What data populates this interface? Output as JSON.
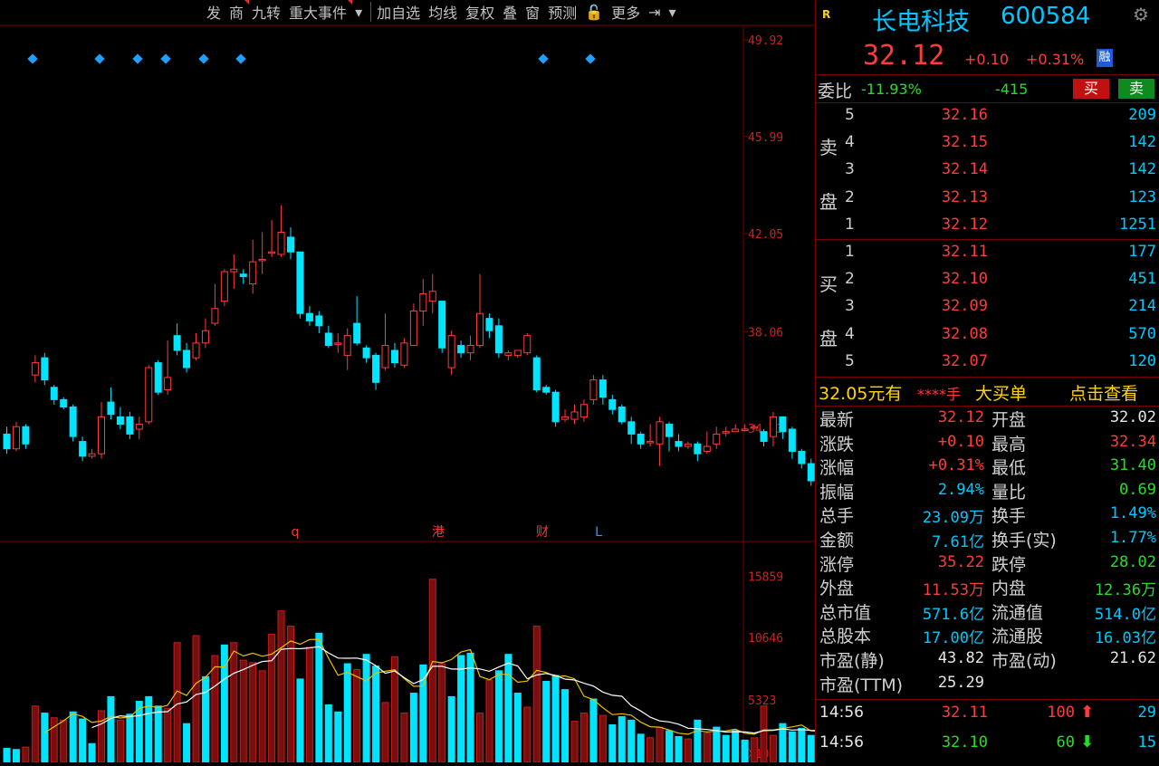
{
  "toolbar": {
    "items": [
      "发",
      "商",
      "九转",
      "重大事件",
      "▾",
      "加自选",
      "均线",
      "复权",
      "叠",
      "窗",
      "预测",
      "🔓",
      "更多",
      "⇥",
      "▾"
    ]
  },
  "price_axis": [
    "49.92",
    "45.99",
    "42.05",
    "38.06",
    "34.13"
  ],
  "volume_axis": [
    "15859",
    "10646",
    "5323",
    "X100"
  ],
  "event_markers": [
    "q",
    "港",
    "财",
    "L"
  ],
  "stock": {
    "name": "长电科技",
    "code": "600584",
    "price": "32.12",
    "change": "+0.10",
    "pct": "+0.31%",
    "badge": "融",
    "tag": "R"
  },
  "weibi": {
    "label": "委比",
    "pct": "-11.93%",
    "diff": "-415",
    "buy_btn": "买",
    "sell_btn": "卖"
  },
  "sell_side": {
    "label1": "卖",
    "label2": "盘",
    "levels": [
      {
        "n": "5",
        "price": "32.16",
        "vol": "209"
      },
      {
        "n": "4",
        "price": "32.15",
        "vol": "142"
      },
      {
        "n": "3",
        "price": "32.14",
        "vol": "142"
      },
      {
        "n": "2",
        "price": "32.13",
        "vol": "123"
      },
      {
        "n": "1",
        "price": "32.12",
        "vol": "1251"
      }
    ]
  },
  "buy_side": {
    "label1": "买",
    "label2": "盘",
    "levels": [
      {
        "n": "1",
        "price": "32.11",
        "vol": "177"
      },
      {
        "n": "2",
        "price": "32.10",
        "vol": "451"
      },
      {
        "n": "3",
        "price": "32.09",
        "vol": "214"
      },
      {
        "n": "4",
        "price": "32.08",
        "vol": "570"
      },
      {
        "n": "5",
        "price": "32.07",
        "vol": "120"
      }
    ]
  },
  "big_order": {
    "price": "32.05元有",
    "hands": "****手",
    "label": "大买单",
    "link": "点击查看"
  },
  "stats": [
    {
      "l1": "最新",
      "v1": "32.12",
      "c1": "red",
      "l2": "开盘",
      "v2": "32.02",
      "c2": "white"
    },
    {
      "l1": "涨跌",
      "v1": "+0.10",
      "c1": "red",
      "l2": "最高",
      "v2": "32.34",
      "c2": "red"
    },
    {
      "l1": "涨幅",
      "v1": "+0.31%",
      "c1": "red",
      "l2": "最低",
      "v2": "31.40",
      "c2": "green"
    },
    {
      "l1": "振幅",
      "v1": "2.94%",
      "c1": "cyan",
      "l2": "量比",
      "v2": "0.69",
      "c2": "green"
    },
    {
      "l1": "总手",
      "v1": "23.09万",
      "c1": "cyan",
      "l2": "换手",
      "v2": "1.49%",
      "c2": "cyan"
    },
    {
      "l1": "金额",
      "v1": "7.61亿",
      "c1": "cyan",
      "l2": "换手(实)",
      "v2": "1.77%",
      "c2": "cyan"
    },
    {
      "l1": "涨停",
      "v1": "35.22",
      "c1": "red",
      "l2": "跌停",
      "v2": "28.02",
      "c2": "green"
    },
    {
      "l1": "外盘",
      "v1": "11.53万",
      "c1": "red",
      "l2": "内盘",
      "v2": "12.36万",
      "c2": "green"
    },
    {
      "l1": "总市值",
      "v1": "571.6亿",
      "c1": "cyan",
      "l2": "流通值",
      "v2": "514.0亿",
      "c2": "cyan"
    },
    {
      "l1": "总股本",
      "v1": "17.00亿",
      "c1": "cyan",
      "l2": "流通股",
      "v2": "16.03亿",
      "c2": "cyan"
    },
    {
      "l1": "市盈(静)",
      "v1": "43.82",
      "c1": "white",
      "l2": "市盈(动)",
      "v2": "21.62",
      "c2": "white"
    },
    {
      "l1": "市盈(TTM)",
      "v1": "25.29",
      "c1": "white",
      "l2": "",
      "v2": "",
      "c2": "white"
    }
  ],
  "ticks": [
    {
      "time": "14:56",
      "price": "32.11",
      "vol": "100",
      "dir": "up",
      "count": "29"
    },
    {
      "time": "14:56",
      "price": "32.10",
      "vol": "60",
      "dir": "down",
      "count": "15"
    }
  ],
  "colors": {
    "up": "#ff3b3b",
    "down": "#00e5ff",
    "ma5": "#ffffff",
    "ma10": "#e8c000",
    "grid": "#7a0000"
  },
  "chart_data": {
    "type": "candlestick",
    "price_ylim": [
      30.2,
      50.8
    ],
    "candles": [
      [
        33.9,
        33.3,
        34.2,
        33.1
      ],
      [
        33.3,
        34.2,
        34.4,
        33.2
      ],
      [
        34.2,
        33.5,
        34.3,
        33.3
      ],
      [
        36.3,
        36.8,
        37.1,
        36.0
      ],
      [
        37.0,
        36.1,
        37.2,
        35.9
      ],
      [
        35.8,
        35.3,
        35.9,
        35.1
      ],
      [
        35.3,
        35.0,
        35.4,
        34.9
      ],
      [
        35.0,
        33.8,
        35.1,
        33.6
      ],
      [
        33.6,
        33.0,
        33.8,
        32.8
      ],
      [
        33.0,
        33.1,
        33.3,
        32.9
      ],
      [
        33.1,
        34.6,
        35.2,
        32.9
      ],
      [
        35.2,
        34.7,
        35.8,
        34.5
      ],
      [
        34.6,
        34.3,
        35.0,
        34.1
      ],
      [
        34.6,
        33.9,
        34.8,
        33.7
      ],
      [
        34.1,
        34.3,
        34.6,
        33.7
      ],
      [
        34.4,
        36.6,
        36.7,
        34.3
      ],
      [
        36.8,
        35.6,
        36.9,
        35.5
      ],
      [
        35.7,
        36.2,
        37.7,
        35.5
      ],
      [
        37.9,
        37.3,
        38.4,
        37.1
      ],
      [
        37.3,
        36.6,
        37.6,
        36.4
      ],
      [
        37.0,
        37.6,
        38.0,
        36.9
      ],
      [
        37.6,
        38.1,
        38.6,
        37.4
      ],
      [
        38.4,
        39.0,
        40.0,
        38.3
      ],
      [
        39.3,
        40.5,
        40.6,
        39.1
      ],
      [
        40.5,
        40.6,
        41.2,
        39.8
      ],
      [
        40.4,
        40.3,
        40.6,
        40.0
      ],
      [
        40.0,
        40.9,
        41.8,
        39.6
      ],
      [
        41.0,
        41.0,
        42.1,
        40.4
      ],
      [
        41.3,
        41.3,
        42.6,
        41.1
      ],
      [
        41.2,
        42.1,
        43.2,
        41.1
      ],
      [
        41.9,
        41.3,
        42.3,
        41.0
      ],
      [
        41.3,
        38.8,
        41.3,
        38.6
      ],
      [
        38.8,
        38.5,
        39.1,
        38.3
      ],
      [
        38.7,
        38.3,
        38.9,
        38.0
      ],
      [
        38.0,
        37.5,
        38.3,
        37.4
      ],
      [
        37.6,
        37.6,
        38.0,
        37.2
      ],
      [
        37.1,
        37.9,
        38.2,
        36.5
      ],
      [
        38.4,
        37.6,
        39.5,
        37.5
      ],
      [
        37.4,
        37.0,
        37.5,
        36.8
      ],
      [
        37.1,
        36.0,
        37.2,
        35.7
      ],
      [
        36.6,
        37.5,
        38.8,
        36.5
      ],
      [
        37.3,
        36.8,
        37.6,
        36.6
      ],
      [
        36.7,
        37.6,
        37.8,
        36.6
      ],
      [
        37.5,
        38.9,
        39.2,
        37.5
      ],
      [
        38.9,
        39.6,
        40.2,
        38.3
      ],
      [
        39.3,
        39.7,
        40.4,
        38.8
      ],
      [
        39.3,
        37.4,
        39.3,
        37.2
      ],
      [
        36.6,
        37.9,
        38.1,
        36.3
      ],
      [
        37.5,
        37.2,
        37.7,
        37.0
      ],
      [
        37.2,
        37.5,
        37.9,
        36.9
      ],
      [
        37.5,
        38.8,
        40.4,
        37.4
      ],
      [
        38.6,
        38.1,
        38.8,
        37.8
      ],
      [
        38.3,
        37.2,
        38.6,
        37.0
      ],
      [
        37.1,
        37.2,
        37.3,
        36.9
      ],
      [
        37.1,
        37.3,
        37.3,
        37.0
      ],
      [
        37.2,
        37.9,
        38.0,
        37.1
      ],
      [
        37.0,
        35.7,
        37.1,
        35.6
      ],
      [
        35.8,
        35.6,
        35.9,
        35.5
      ],
      [
        35.6,
        34.4,
        35.7,
        34.2
      ],
      [
        34.5,
        34.6,
        34.9,
        34.4
      ],
      [
        34.5,
        34.8,
        35.1,
        34.3
      ],
      [
        34.6,
        35.1,
        35.3,
        34.4
      ],
      [
        35.3,
        36.1,
        36.3,
        35.1
      ],
      [
        36.1,
        35.4,
        36.3,
        35.1
      ],
      [
        35.3,
        34.9,
        35.5,
        34.7
      ],
      [
        35.0,
        34.4,
        35.1,
        34.3
      ],
      [
        34.4,
        33.9,
        34.6,
        33.5
      ],
      [
        33.9,
        33.5,
        34.0,
        33.3
      ],
      [
        33.6,
        33.6,
        34.3,
        33.4
      ],
      [
        33.5,
        34.4,
        34.6,
        32.6
      ],
      [
        34.3,
        33.8,
        34.4,
        33.2
      ],
      [
        33.6,
        33.4,
        33.9,
        33.2
      ],
      [
        33.4,
        33.5,
        33.6,
        33.3
      ],
      [
        33.5,
        33.1,
        33.6,
        32.8
      ],
      [
        33.2,
        33.4,
        34.0,
        33.1
      ],
      [
        33.5,
        33.9,
        34.2,
        33.3
      ],
      [
        34.0,
        34.0,
        34.2,
        33.8
      ],
      [
        34.0,
        34.1,
        34.3,
        34.0
      ],
      [
        34.1,
        34.1,
        34.3,
        34.0
      ],
      [
        34.2,
        34.2,
        34.3,
        34.1
      ],
      [
        34.0,
        33.6,
        34.1,
        33.4
      ],
      [
        33.8,
        34.6,
        34.8,
        33.4
      ],
      [
        34.6,
        34.0,
        34.6,
        33.7
      ],
      [
        34.1,
        33.2,
        34.2,
        32.9
      ],
      [
        33.2,
        32.7,
        33.3,
        32.5
      ],
      [
        32.7,
        32.0,
        32.9,
        31.8
      ],
      [
        32.0,
        32.1,
        32.3,
        31.4
      ]
    ],
    "volume_ylim": [
      0,
      16500
    ],
    "volumes": [
      [
        1200,
        "d"
      ],
      [
        1100,
        "d"
      ],
      [
        1300,
        "u"
      ],
      [
        4800,
        "u"
      ],
      [
        4200,
        "d"
      ],
      [
        3800,
        "u"
      ],
      [
        3600,
        "u"
      ],
      [
        4300,
        "d"
      ],
      [
        3700,
        "d"
      ],
      [
        1600,
        "d"
      ],
      [
        4400,
        "u"
      ],
      [
        5600,
        "d"
      ],
      [
        3600,
        "u"
      ],
      [
        4100,
        "d"
      ],
      [
        5200,
        "d"
      ],
      [
        5600,
        "d"
      ],
      [
        4800,
        "d"
      ],
      [
        4600,
        "u"
      ],
      [
        10200,
        "u"
      ],
      [
        3300,
        "d"
      ],
      [
        10800,
        "u"
      ],
      [
        7300,
        "d"
      ],
      [
        9100,
        "u"
      ],
      [
        10000,
        "d"
      ],
      [
        10200,
        "u"
      ],
      [
        8700,
        "u"
      ],
      [
        8500,
        "u"
      ],
      [
        7800,
        "u"
      ],
      [
        10900,
        "u"
      ],
      [
        12900,
        "u"
      ],
      [
        11600,
        "u"
      ],
      [
        7100,
        "d"
      ],
      [
        9800,
        "u"
      ],
      [
        11000,
        "d"
      ],
      [
        4900,
        "d"
      ],
      [
        4300,
        "d"
      ],
      [
        8400,
        "d"
      ],
      [
        7900,
        "u"
      ],
      [
        9200,
        "d"
      ],
      [
        8200,
        "d"
      ],
      [
        5100,
        "u"
      ],
      [
        9000,
        "u"
      ],
      [
        4200,
        "u"
      ],
      [
        5900,
        "d"
      ],
      [
        8300,
        "d"
      ],
      [
        15600,
        "u"
      ],
      [
        8400,
        "u"
      ],
      [
        5600,
        "d"
      ],
      [
        9100,
        "d"
      ],
      [
        9300,
        "d"
      ],
      [
        4200,
        "u"
      ],
      [
        7000,
        "u"
      ],
      [
        7800,
        "d"
      ],
      [
        9200,
        "d"
      ],
      [
        5900,
        "d"
      ],
      [
        4700,
        "u"
      ],
      [
        11600,
        "u"
      ],
      [
        6900,
        "d"
      ],
      [
        7400,
        "d"
      ],
      [
        6200,
        "d"
      ],
      [
        3500,
        "u"
      ],
      [
        4200,
        "u"
      ],
      [
        5400,
        "d"
      ],
      [
        4000,
        "u"
      ],
      [
        3200,
        "d"
      ],
      [
        3900,
        "d"
      ],
      [
        3600,
        "d"
      ],
      [
        2400,
        "d"
      ],
      [
        2100,
        "u"
      ],
      [
        3000,
        "u"
      ],
      [
        2700,
        "d"
      ],
      [
        2200,
        "d"
      ],
      [
        2000,
        "u"
      ],
      [
        3600,
        "d"
      ],
      [
        2500,
        "u"
      ],
      [
        3000,
        "d"
      ],
      [
        2300,
        "d"
      ],
      [
        2700,
        "d"
      ],
      [
        1900,
        "d"
      ],
      [
        2100,
        "u"
      ],
      [
        4800,
        "u"
      ],
      [
        2300,
        "u"
      ],
      [
        3300,
        "d"
      ],
      [
        2600,
        "d"
      ],
      [
        2900,
        "d"
      ],
      [
        2300,
        "d"
      ],
      [
        2100,
        "u"
      ]
    ]
  }
}
